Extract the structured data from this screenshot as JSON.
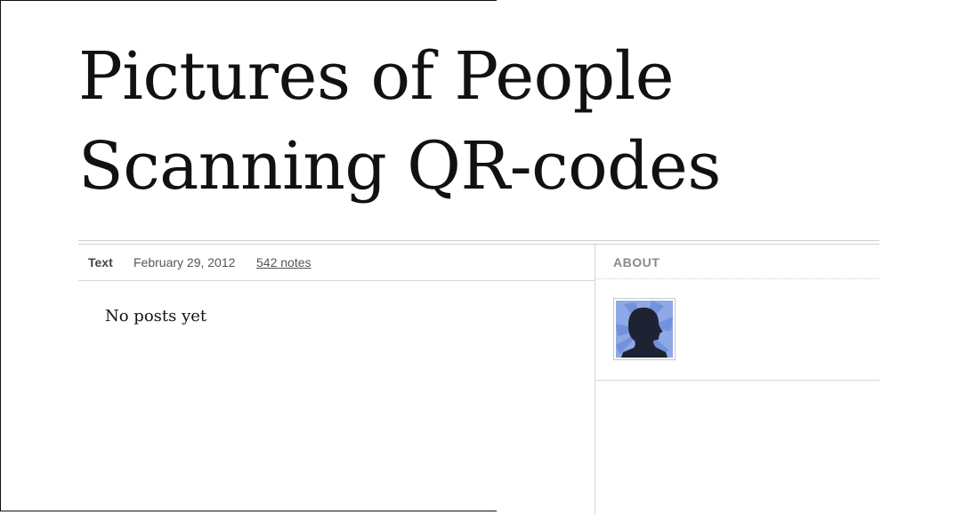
{
  "blog": {
    "title_line1": "Pictures of People",
    "title_line2": "Scanning QR-codes"
  },
  "post": {
    "type": "Text",
    "date": "February 29, 2012",
    "notes": "542 notes",
    "empty_message": "No posts yet"
  },
  "sidebar": {
    "heading": "ABOUT",
    "avatar_icon": "default-silhouette-avatar"
  }
}
